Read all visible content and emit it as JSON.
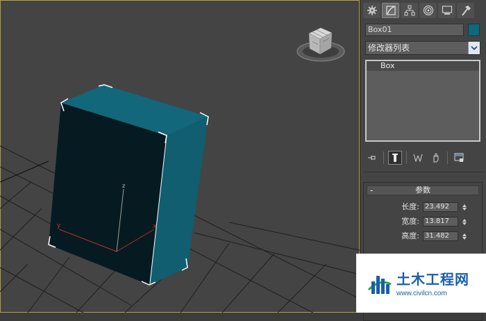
{
  "command_panel": {
    "tabs": [
      {
        "name": "create-tab",
        "icon": "sun-gear-icon"
      },
      {
        "name": "modify-tab",
        "icon": "modify-icon"
      },
      {
        "name": "hierarchy-tab",
        "icon": "hierarchy-icon"
      },
      {
        "name": "motion-tab",
        "icon": "motion-icon"
      },
      {
        "name": "display-tab",
        "icon": "display-icon"
      },
      {
        "name": "utilities-tab",
        "icon": "hammer-icon"
      }
    ],
    "object_name": "Box01",
    "object_color": "#12677a",
    "modifier_list_label": "修改器列表",
    "modifier_stack": [
      "Box"
    ],
    "stack_tools": [
      "pin-stack-icon",
      "show-end-result-icon",
      "make-unique-icon",
      "remove-modifier-icon",
      "configure-sets-icon"
    ]
  },
  "parameters": {
    "title": "参数",
    "collapse_symbol": "-",
    "rows": [
      {
        "label": "长度:",
        "value": "23.492"
      },
      {
        "label": "宽度:",
        "value": "13.817"
      },
      {
        "label": "高度:",
        "value": "31.482"
      }
    ]
  },
  "viewport": {
    "axis_labels": {
      "x": "x",
      "y": "y",
      "z": "z"
    },
    "box_color": "#12677a",
    "viewcube": "viewcube-icon"
  },
  "watermark": {
    "title": "土木工程网",
    "url": "www.civilcn.com"
  },
  "colors": {
    "viewport_bg": "#444444",
    "panel_bg": "#444444",
    "viewport_border": "#b7a13a",
    "selection": "#ffffff"
  }
}
